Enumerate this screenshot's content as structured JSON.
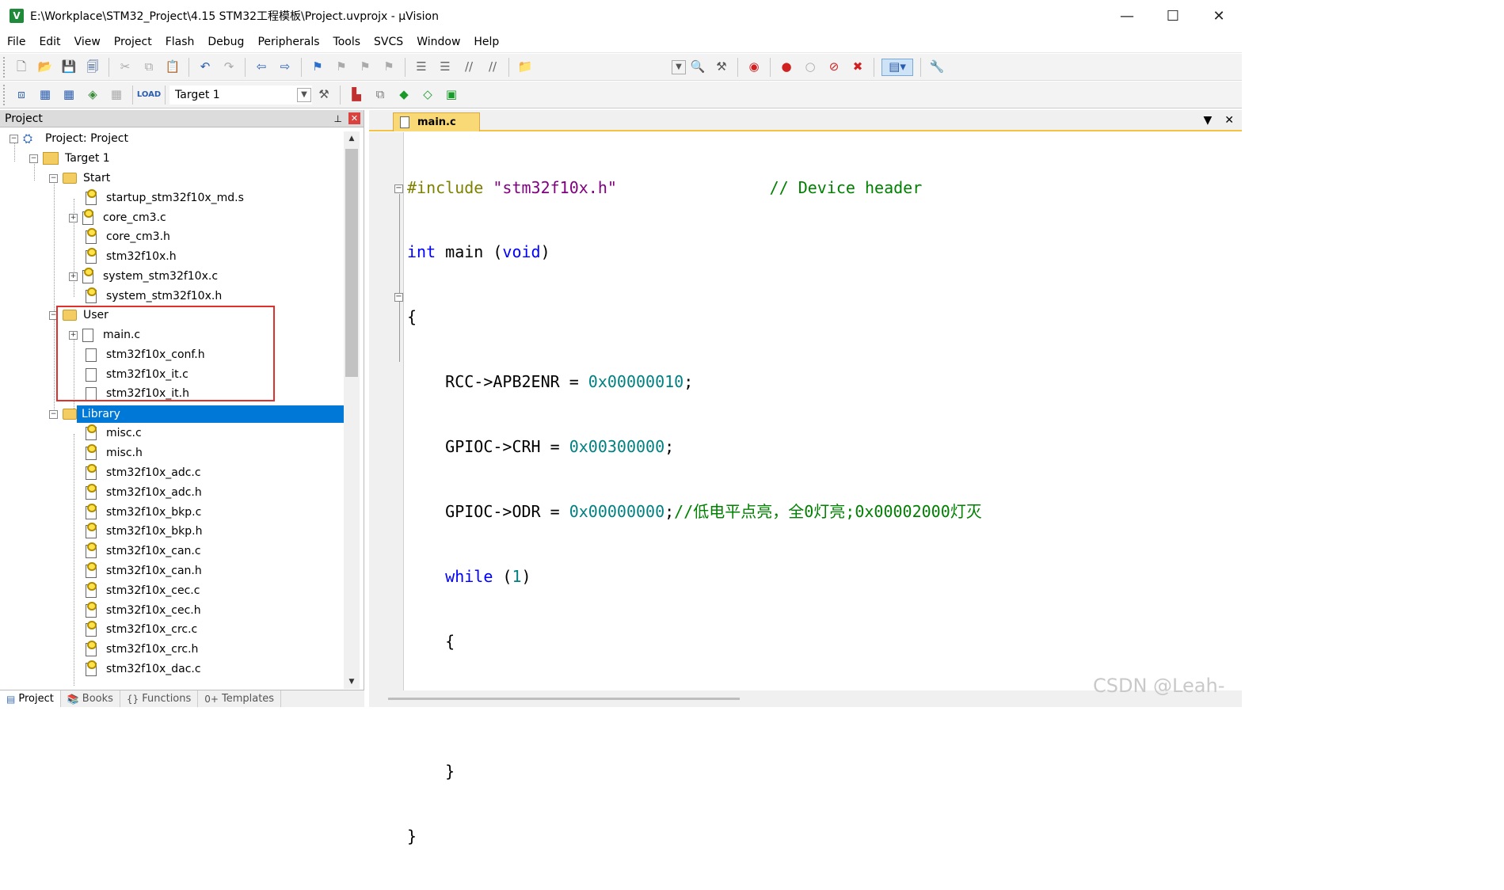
{
  "window": {
    "title": "E:\\Workplace\\STM32_Project\\4.15 STM32工程模板\\Project.uvprojx - µVision",
    "app_icon": "V",
    "minimize": "—",
    "maximize": "☐",
    "close": "✕"
  },
  "menu": [
    "File",
    "Edit",
    "View",
    "Project",
    "Flash",
    "Debug",
    "Peripherals",
    "Tools",
    "SVCS",
    "Window",
    "Help"
  ],
  "toolbar2": {
    "target_label": "Target 1"
  },
  "project_panel": {
    "title": "Project",
    "pin": "⊥",
    "close": "✕",
    "root": "Project: Project",
    "target": "Target 1",
    "groups": {
      "start": {
        "label": "Start",
        "files": [
          "startup_stm32f10x_md.s",
          "core_cm3.c",
          "core_cm3.h",
          "stm32f10x.h",
          "system_stm32f10x.c",
          "system_stm32f10x.h"
        ]
      },
      "user": {
        "label": "User",
        "files": [
          "main.c",
          "stm32f10x_conf.h",
          "stm32f10x_it.c",
          "stm32f10x_it.h"
        ]
      },
      "library": {
        "label": "Library",
        "files": [
          "misc.c",
          "misc.h",
          "stm32f10x_adc.c",
          "stm32f10x_adc.h",
          "stm32f10x_bkp.c",
          "stm32f10x_bkp.h",
          "stm32f10x_can.c",
          "stm32f10x_can.h",
          "stm32f10x_cec.c",
          "stm32f10x_cec.h",
          "stm32f10x_crc.c",
          "stm32f10x_crc.h",
          "stm32f10x_dac.c"
        ]
      }
    },
    "bottom_tabs": [
      "Project",
      "Books",
      "Functions",
      "Templates"
    ]
  },
  "editor": {
    "tab": "main.c",
    "lines": {
      "l1_pp": "#include ",
      "l1_str": "\"stm32f10x.h\"",
      "l1_cmt": "                // Device header",
      "l2_kw1": "int",
      "l2_mid": " main ",
      "l2_p1": "(",
      "l2_kw2": "void",
      "l2_p2": ")",
      "l3": "{",
      "l4_a": "    RCC->APB2ENR = ",
      "l4_num": "0x00000010",
      "l4_b": ";",
      "l5_a": "    GPIOC->CRH = ",
      "l5_num": "0x00300000",
      "l5_b": ";",
      "l6_a": "    GPIOC->ODR = ",
      "l6_num": "0x00000000",
      "l6_b": ";",
      "l6_cmt": "//低电平点亮，全0灯亮;0x00002000灯灭",
      "l7_kw": "    while",
      "l7_a": " (",
      "l7_num": "1",
      "l7_b": ")",
      "l8": "    {",
      "l9": "",
      "l10": "    }",
      "l11": "}"
    }
  },
  "watermark": "CSDN @Leah-"
}
